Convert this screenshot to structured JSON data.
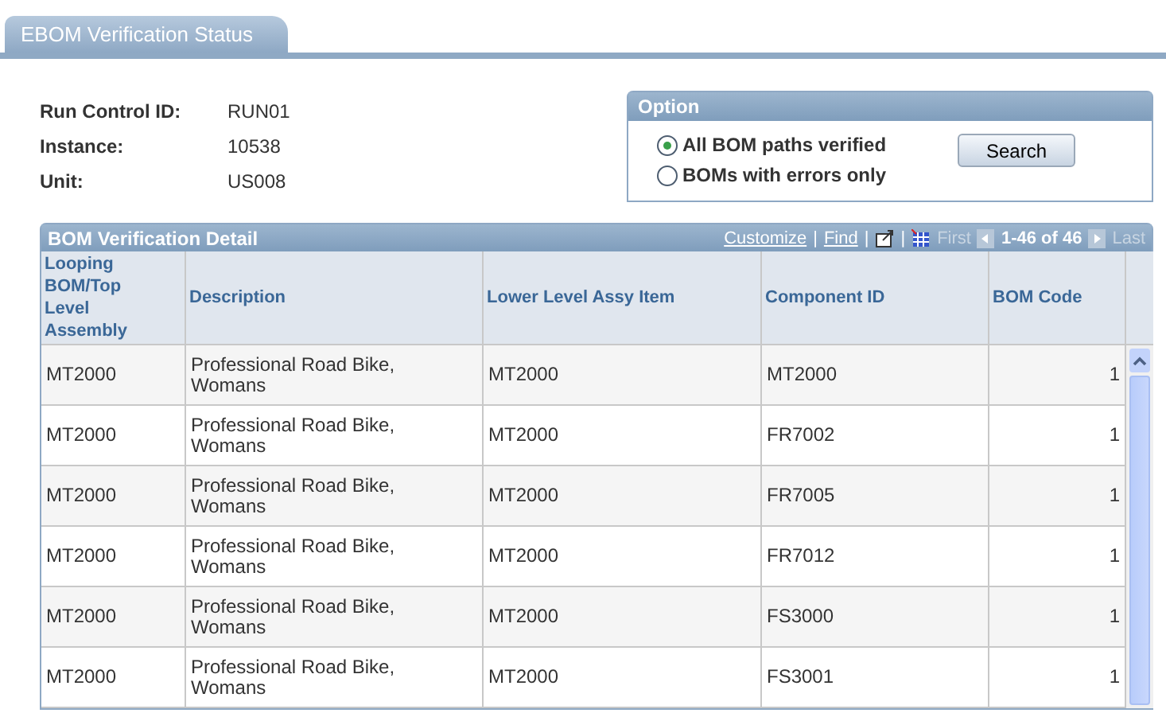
{
  "tab": {
    "label": "EBOM Verification Status"
  },
  "fields": [
    {
      "label": "Run Control ID:",
      "value": "RUN01"
    },
    {
      "label": "Instance:",
      "value": "10538"
    },
    {
      "label": "Unit:",
      "value": "US008"
    }
  ],
  "option": {
    "title": "Option",
    "radios": [
      {
        "label": "All BOM paths verified",
        "selected": true
      },
      {
        "label": "BOMs with errors only",
        "selected": false
      }
    ],
    "button": "Search"
  },
  "grid": {
    "title": "BOM Verification Detail",
    "links": [
      "Customize",
      "Find"
    ],
    "separators": [
      "|",
      "|",
      "|"
    ],
    "first": "First",
    "range": "1-46 of 46",
    "last": "Last",
    "columns": [
      "Looping BOM/Top Level Assembly",
      "Description",
      "Lower Level Assy Item",
      "Component ID",
      "BOM Code"
    ],
    "rows": [
      [
        "MT2000",
        "Professional Road Bike, Womans",
        "MT2000",
        "MT2000",
        "1"
      ],
      [
        "MT2000",
        "Professional Road Bike, Womans",
        "MT2000",
        "FR7002",
        "1"
      ],
      [
        "MT2000",
        "Professional Road Bike, Womans",
        "MT2000",
        "FR7005",
        "1"
      ],
      [
        "MT2000",
        "Professional Road Bike, Womans",
        "MT2000",
        "FR7012",
        "1"
      ],
      [
        "MT2000",
        "Professional Road Bike, Womans",
        "MT2000",
        "FS3000",
        "1"
      ],
      [
        "MT2000",
        "Professional Road Bike, Womans",
        "MT2000",
        "FS3001",
        "1"
      ]
    ]
  }
}
